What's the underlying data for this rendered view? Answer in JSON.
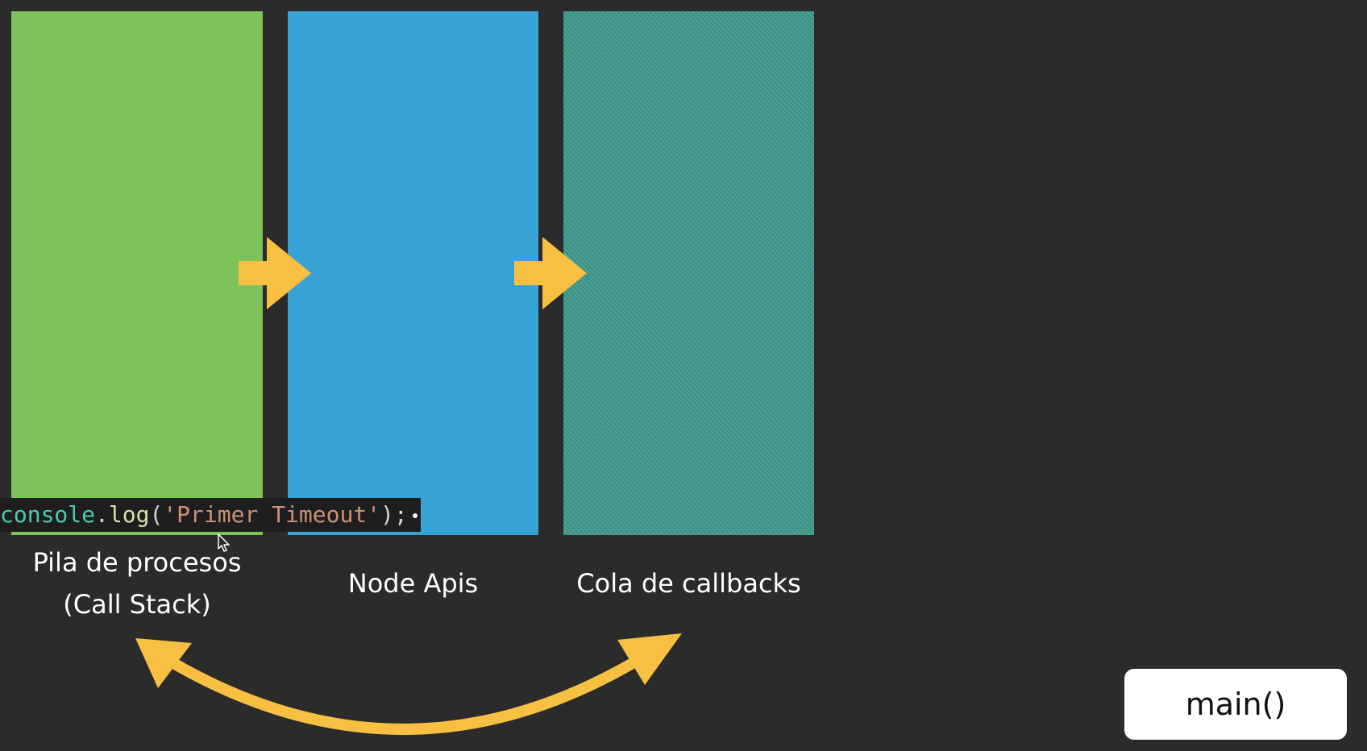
{
  "columns": {
    "stack": {
      "label_line1": "Pila de procesos",
      "label_line2": "(Call Stack)",
      "color": "#7ec25a"
    },
    "apis": {
      "label": "Node Apis",
      "color": "#38a2d5"
    },
    "queue": {
      "label": "Cola de callbacks",
      "color": "#3f9a8c"
    }
  },
  "code_chip": {
    "ident": "console",
    "dot": ".",
    "fn": "log",
    "open": "(",
    "string": "'Primer Timeout'",
    "close": ");"
  },
  "main_box": {
    "label": "main()"
  },
  "colors": {
    "background": "#2b2b2b",
    "arrow": "#f7c042"
  },
  "icons": [
    "arrow-right-icon",
    "arrow-right-icon",
    "curved-double-arrow-icon",
    "mouse-pointer-icon"
  ]
}
